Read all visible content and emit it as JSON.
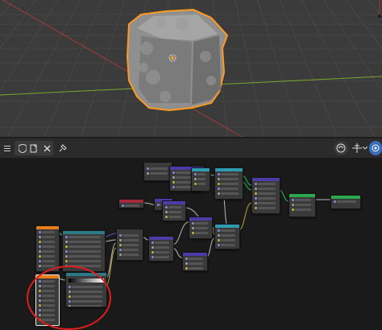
{
  "app": {
    "name": "Blender"
  },
  "viewport": {
    "background": "#3b3b3b",
    "grid_color": "#4a4a4a",
    "x_axis_color": "#a83838",
    "y_axis_color": "#7aa82a",
    "selection_color": "#ff9a1f",
    "object": "rock-cube"
  },
  "node_editor": {
    "header": {
      "buttons": [
        {
          "name": "menu-icon"
        },
        {
          "name": "shield-icon"
        },
        {
          "name": "copy-icon"
        },
        {
          "name": "close-icon"
        },
        {
          "name": "pin-icon"
        },
        {
          "name": "overlay-icon"
        },
        {
          "name": "gizmo-icon"
        },
        {
          "name": "view-icon"
        }
      ]
    },
    "accent_colors": {
      "texture": "#e87d1c",
      "input": "#a12b3b",
      "converter": "#2f9bb3",
      "vector": "#4d3ba8",
      "shader": "#2aa84b",
      "link_default": "#c8c8c8",
      "link_vector": "#5a5ad6",
      "link_value": "#c7b23a",
      "link_shader": "#2ec765"
    },
    "annotation": {
      "shape": "circle",
      "color": "#e11d1d"
    }
  }
}
